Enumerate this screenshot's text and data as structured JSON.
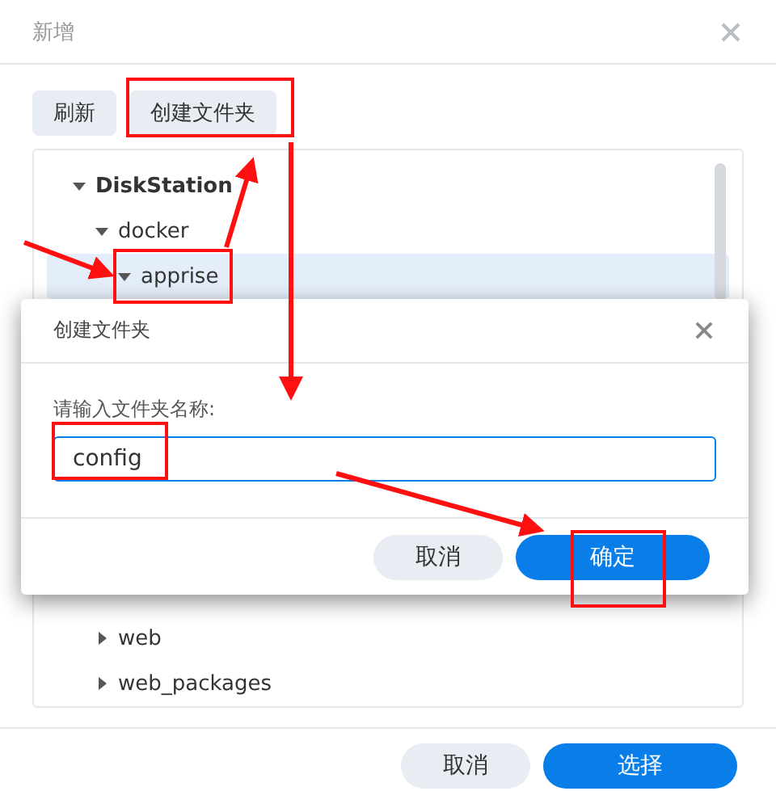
{
  "window": {
    "title": "新增"
  },
  "toolbar": [
    {
      "label": "刷新"
    },
    {
      "label": "创建文件夹"
    }
  ],
  "tree": [
    {
      "label": "DiskStation",
      "expanded": true,
      "selected": false,
      "children": [
        {
          "label": "docker",
          "expanded": true,
          "selected": false,
          "children": [
            {
              "label": "apprise",
              "expanded": true,
              "selected": true
            }
          ]
        },
        {
          "label": "web",
          "expanded": false,
          "selected": false
        },
        {
          "label": "web_packages",
          "expanded": false,
          "selected": false
        }
      ]
    }
  ],
  "footer_buttons": [
    {
      "label": "取消",
      "kind": "secondary"
    },
    {
      "label": "选择",
      "kind": "primary"
    }
  ],
  "modal": {
    "title": "创建文件夹",
    "label": "请输入文件夹名称:",
    "value": "config",
    "buttons": [
      {
        "label": "取消",
        "kind": "secondary"
      },
      {
        "label": "确定",
        "kind": "primary"
      }
    ]
  }
}
